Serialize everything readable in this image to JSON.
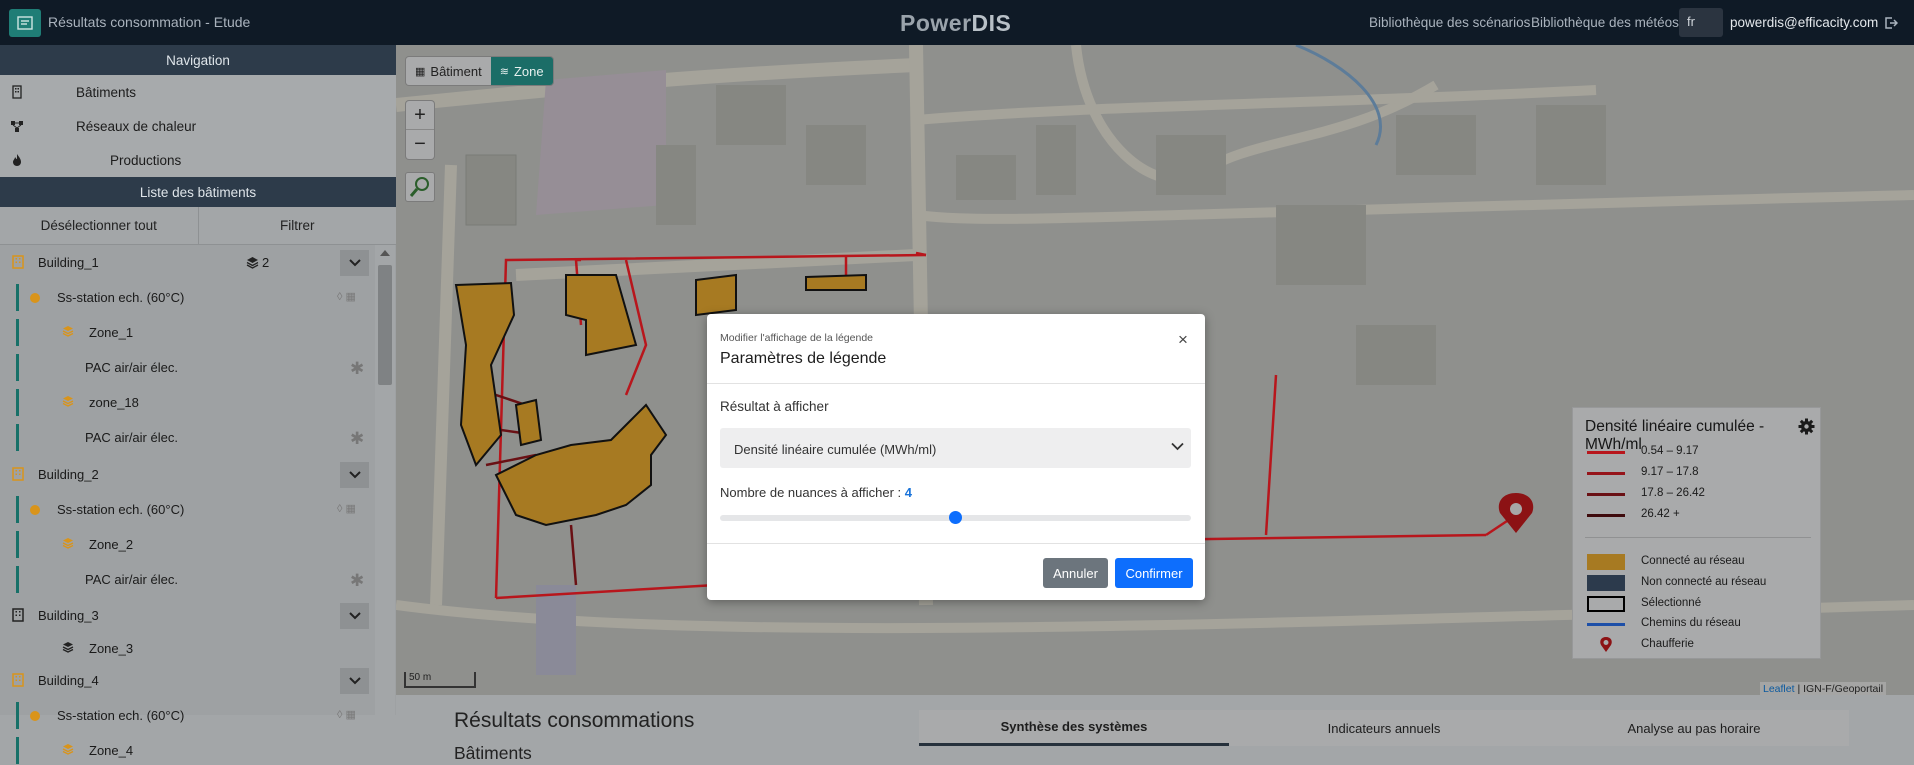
{
  "header": {
    "title": "Résultats consommation - Etude",
    "brand_main": "Power",
    "brand_accent": "DIS",
    "link_scenarios": "Bibliothèque des scénarios",
    "link_meteo": "Bibliothèque des météos",
    "language": "fr",
    "user_email": "powerdis@efficacity.com"
  },
  "sidebar": {
    "navigation_header": "Navigation",
    "nav_items": [
      {
        "label": "Bâtiments",
        "icon": "building-icon"
      },
      {
        "label": "Réseaux de chaleur",
        "icon": "network-icon"
      },
      {
        "label": "Productions",
        "icon": "flame-icon"
      }
    ],
    "list_header": "Liste des bâtiments",
    "deselect_all": "Désélectionner tout",
    "filter": "Filtrer",
    "tree": {
      "b1": "Building_1",
      "b1_zone_count": "2",
      "b1_station": "Ss-station ech. (60°C)",
      "b1_zone1": "Zone_1",
      "b1_pac1": "PAC air/air élec.",
      "b1_zone2": "zone_18",
      "b1_pac2": "PAC air/air élec.",
      "b2": "Building_2",
      "b2_station": "Ss-station ech. (60°C)",
      "b2_zone": "Zone_2",
      "b2_pac": "PAC air/air élec.",
      "b3": "Building_3",
      "b3_zone": "Zone_3",
      "b4": "Building_4",
      "b4_station": "Ss-station ech. (60°C)",
      "b4_zone": "Zone_4"
    }
  },
  "map": {
    "toggle_batiment": "Bâtiment",
    "toggle_zone": "Zone",
    "zoom_in": "+",
    "zoom_out": "−",
    "scale_label": "50 m",
    "attribution_leaflet": "Leaflet",
    "attribution_rest": " | IGN-F/Geoportail"
  },
  "legend": {
    "title": "Densité linéaire cumulée - MWh/ml",
    "ranges": [
      {
        "label": "0.54 – 9.17",
        "color": "#b8161c"
      },
      {
        "label": "9.17 – 17.8",
        "color": "#96141a"
      },
      {
        "label": "17.8 – 26.42",
        "color": "#6a1014"
      },
      {
        "label": "26.42 +",
        "color": "#3e0a0c"
      }
    ],
    "items": [
      {
        "label": "Connecté au réseau",
        "color": "#a77a22"
      },
      {
        "label": "Non connecté au réseau",
        "color": "#2c3a4c"
      },
      {
        "label": "Sélectionné",
        "color": "#000000"
      },
      {
        "label": "Chemins du réseau",
        "color": "#1d4fa8"
      },
      {
        "label": "Chaufferie",
        "color": "#b21c1c"
      }
    ]
  },
  "results": {
    "title": "Résultats consommations",
    "subtitle": "Bâtiments",
    "tabs": [
      "Synthèse des systèmes",
      "Indicateurs annuels",
      "Analyse au pas horaire"
    ]
  },
  "modal": {
    "subtitle": "Modifier l'affichage de la légende",
    "title": "Paramètres de légende",
    "close": "×",
    "result_label": "Résultat à afficher",
    "result_value": "Densité linéaire cumulée (MWh/ml)",
    "nuances_label": "Nombre de nuances à afficher : ",
    "nuances_value": "4",
    "slider_fraction": 0.5,
    "cancel": "Annuler",
    "confirm": "Confirmer"
  }
}
